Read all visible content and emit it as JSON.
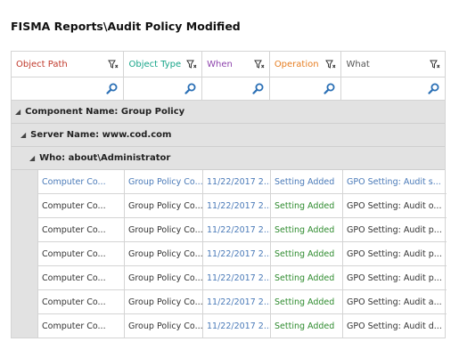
{
  "title": "FISMA Reports\\Audit Policy Modified",
  "colors": {
    "object_path": "#c0392b",
    "object_type": "#17a589",
    "when": "#8e44ad",
    "operation": "#e67e22",
    "what": "#555555",
    "group_bg": "#e2e2e2",
    "link_blue": "#4a7ab8",
    "setting_green": "#2e8b2e"
  },
  "columns": [
    {
      "label": "Object Path"
    },
    {
      "label": "Object Type"
    },
    {
      "label": "When"
    },
    {
      "label": "Operation"
    },
    {
      "label": "What"
    }
  ],
  "groups": {
    "component": "Component Name: Group Policy",
    "server": "Server Name: www.cod.com",
    "who": "Who: about\\Administrator"
  },
  "rows": [
    [
      "Computer Co...",
      "Group Policy Co...",
      "11/22/2017 2...",
      "Setting Added",
      "GPO Setting: Audit s..."
    ],
    [
      "Computer Co...",
      "Group Policy Co...",
      "11/22/2017 2...",
      "Setting Added",
      "GPO Setting: Audit o..."
    ],
    [
      "Computer Co...",
      "Group Policy Co...",
      "11/22/2017 2...",
      "Setting Added",
      "GPO Setting: Audit p..."
    ],
    [
      "Computer Co...",
      "Group Policy Co...",
      "11/22/2017 2...",
      "Setting Added",
      "GPO Setting: Audit p..."
    ],
    [
      "Computer Co...",
      "Group Policy Co...",
      "11/22/2017 2...",
      "Setting Added",
      "GPO Setting: Audit p..."
    ],
    [
      "Computer Co...",
      "Group Policy Co...",
      "11/22/2017 2...",
      "Setting Added",
      "GPO Setting: Audit a..."
    ],
    [
      "Computer Co...",
      "Group Policy Co...",
      "11/22/2017 2...",
      "Setting Added",
      "GPO Setting: Audit d..."
    ]
  ]
}
